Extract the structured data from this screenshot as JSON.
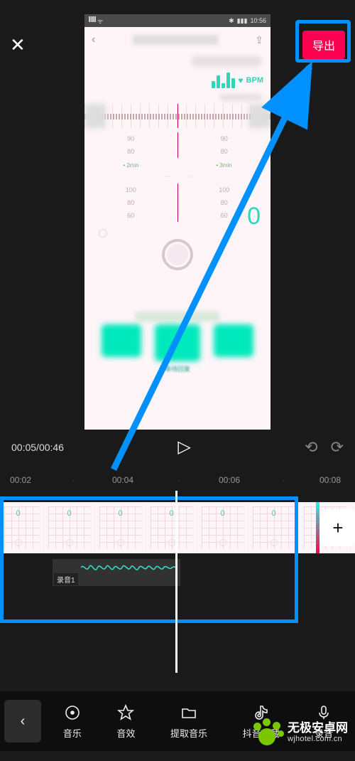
{
  "header": {
    "export_label": "导出"
  },
  "phone": {
    "status_time": "10:56",
    "bpm_label": "BPM",
    "scale_a": [
      "90",
      "80"
    ],
    "scale_b": [
      "100",
      "80",
      "60"
    ],
    "time_a": "2min",
    "time_b": "3min",
    "big_value": "0",
    "bottom_caption": "等待回复"
  },
  "transport": {
    "current": "00:05",
    "total": "00:46"
  },
  "ruler": {
    "t0": "00:02",
    "t1": "00:04",
    "t2": "00:06",
    "t3": "00:08"
  },
  "timeline": {
    "frame_value": "0",
    "add_label": "+",
    "audio_clip_label": "录音1"
  },
  "toolbar": {
    "items": [
      {
        "label": "音乐"
      },
      {
        "label": "音效"
      },
      {
        "label": "提取音乐"
      },
      {
        "label": "抖音收藏"
      },
      {
        "label": "录音"
      }
    ]
  },
  "watermark": {
    "line1": "无极安卓网",
    "line2": "wjhotel.com.cn"
  }
}
